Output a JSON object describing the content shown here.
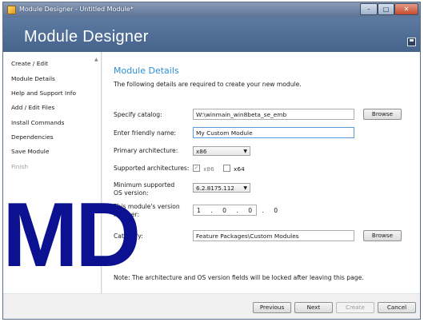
{
  "window": {
    "title": "Module Designer - Untitled Module*",
    "controls": {
      "minimize": "–",
      "maximize": "□",
      "close": "✕"
    }
  },
  "banner": {
    "title": "Module Designer"
  },
  "sidebar": {
    "items": [
      {
        "label": "Create / Edit",
        "state": "normal"
      },
      {
        "label": "Module Details",
        "state": "active"
      },
      {
        "label": "Help and Support Info",
        "state": "normal"
      },
      {
        "label": "Add / Edit Files",
        "state": "normal"
      },
      {
        "label": "Install Commands",
        "state": "normal"
      },
      {
        "label": "Dependencies",
        "state": "normal"
      },
      {
        "label": "Save Module",
        "state": "normal"
      },
      {
        "label": "Finish",
        "state": "disabled"
      }
    ]
  },
  "details": {
    "title": "Module Details",
    "description": "The following details are required to create your new module.",
    "catalog": {
      "label": "Specify catalog:",
      "value": "W:\\winmain_win8beta_se_emb",
      "button": "Browse"
    },
    "friendly_name": {
      "label": "Enter friendly name:",
      "value": "My Custom Module"
    },
    "primary_arch": {
      "label": "Primary architecture:",
      "value": "x86"
    },
    "supported_arch": {
      "label": "Supported architectures:",
      "options": [
        {
          "label": "x86",
          "checked": true,
          "locked": true
        },
        {
          "label": "x64",
          "checked": false,
          "locked": false
        }
      ]
    },
    "min_os": {
      "label_line1": "Minimum supported",
      "label_line2": "OS version:",
      "value": "6.2.8175.112"
    },
    "module_version": {
      "label_line1": "This module's version",
      "label_line2": "number:",
      "parts": [
        "1",
        "0",
        "0",
        "0"
      ]
    },
    "category": {
      "label": "Category:",
      "value": "Feature Packages\\Custom Modules",
      "button": "Browse"
    },
    "note": "Note: The architecture and OS version fields will be locked after leaving this page."
  },
  "footer": {
    "buttons": [
      {
        "label": "Previous",
        "enabled": true
      },
      {
        "label": "Next",
        "enabled": true
      },
      {
        "label": "Create",
        "enabled": false
      },
      {
        "label": "Cancel",
        "enabled": true
      }
    ]
  },
  "watermark": {
    "text": "MD"
  },
  "colors": {
    "accent": "#2e8ed6",
    "banner": "#4f6d97",
    "watermark": "#0b1190"
  }
}
